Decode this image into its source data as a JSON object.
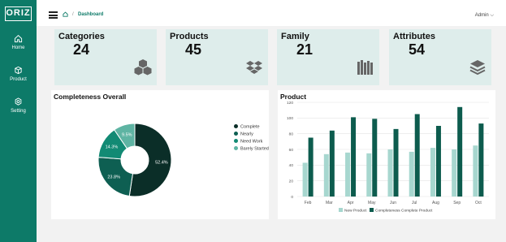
{
  "sidebar": {
    "logo": "ORIZ",
    "items": [
      {
        "label": "Home",
        "icon": "home-icon"
      },
      {
        "label": "Product",
        "icon": "box-icon"
      },
      {
        "label": "Setting",
        "icon": "gear-icon"
      }
    ]
  },
  "header": {
    "breadcrumb_sep": "/",
    "breadcrumb": "Dashboard",
    "user": "Admin ⌵"
  },
  "cards": [
    {
      "title": "Categories",
      "value": "24",
      "icon": "cubes-icon"
    },
    {
      "title": "Products",
      "value": "45",
      "icon": "dropbox-icon"
    },
    {
      "title": "Family",
      "value": "21",
      "icon": "books-icon"
    },
    {
      "title": "Attributes",
      "value": "54",
      "icon": "layers-icon"
    }
  ],
  "completeness": {
    "title": "Completeness Overall"
  },
  "product": {
    "title": "Product"
  },
  "colors": {
    "brand": "#0d7a68",
    "card_bg": "#deedeb",
    "dark": "#0b3b31",
    "mid": "#0f8a74",
    "light": "#86c8bb"
  },
  "chart_data": [
    {
      "type": "pie",
      "labels": [
        "Complete",
        "Nearly",
        "Need Work",
        "Barely Started"
      ],
      "values": [
        52.4,
        23.8,
        14.3,
        9.5
      ],
      "value_labels": [
        "52.4%",
        "23.8%",
        "14.3%",
        "9.5%"
      ],
      "colors": [
        "#0b2e28",
        "#0e5f52",
        "#128a74",
        "#5eb4a3"
      ],
      "legend": "right"
    },
    {
      "type": "bar",
      "categories": [
        "Feb",
        "Mar",
        "Apr",
        "May",
        "Jun",
        "Jul",
        "Aug",
        "Sep",
        "Oct"
      ],
      "series": [
        {
          "name": "New Product",
          "values": [
            43,
            54,
            56,
            55,
            60,
            57,
            62,
            60,
            65
          ],
          "color": "#a7d7cf"
        },
        {
          "name": "Completeness Complete Product",
          "values": [
            75,
            84,
            101,
            99,
            86,
            105,
            90,
            114,
            93
          ],
          "color": "#0d5c4e"
        }
      ],
      "ylim": [
        0,
        120
      ],
      "yticks": [
        0,
        20,
        40,
        60,
        80,
        100,
        120
      ],
      "grid": true,
      "legend": "bottom"
    }
  ]
}
